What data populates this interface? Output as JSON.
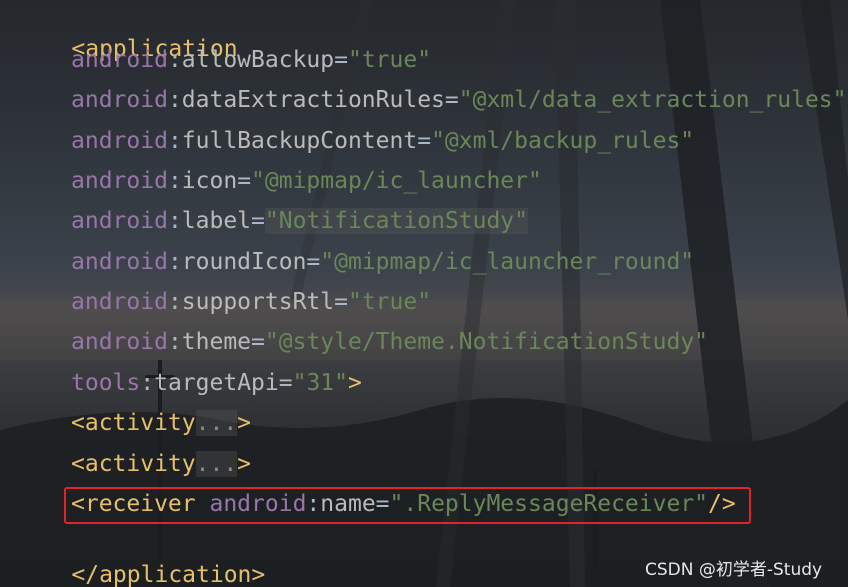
{
  "code": {
    "open_tag": "<application",
    "ns_android": "android",
    "ns_tools": "tools",
    "colon": ":",
    "eq": "=",
    "attrs": [
      {
        "name": "allowBackup",
        "value": "\"true\""
      },
      {
        "name": "dataExtractionRules",
        "value": "\"@xml/data_extraction_rules\""
      },
      {
        "name": "fullBackupContent",
        "value": "\"@xml/backup_rules\""
      },
      {
        "name": "icon",
        "value": "\"@mipmap/ic_launcher\""
      },
      {
        "name": "label",
        "value": "\"NotificationStudy\""
      },
      {
        "name": "roundIcon",
        "value": "\"@mipmap/ic_launcher_round\""
      },
      {
        "name": "supportsRtl",
        "value": "\"true\""
      },
      {
        "name": "theme",
        "value": "\"@style/Theme.NotificationStudy\""
      }
    ],
    "tools_attr": {
      "name": "targetApi",
      "value": "\"31\"",
      "close": ">"
    },
    "activity_tag": "<activity",
    "fold_text": "...",
    "gt": ">",
    "receiver": {
      "open": "<receiver",
      "attr_name": "name",
      "value": "\".ReplyMessageReceiver\"",
      "close": "/>"
    },
    "close_tag": "</application>"
  },
  "highlight_color": "#e0242a",
  "watermark": "CSDN @初学者-Study"
}
